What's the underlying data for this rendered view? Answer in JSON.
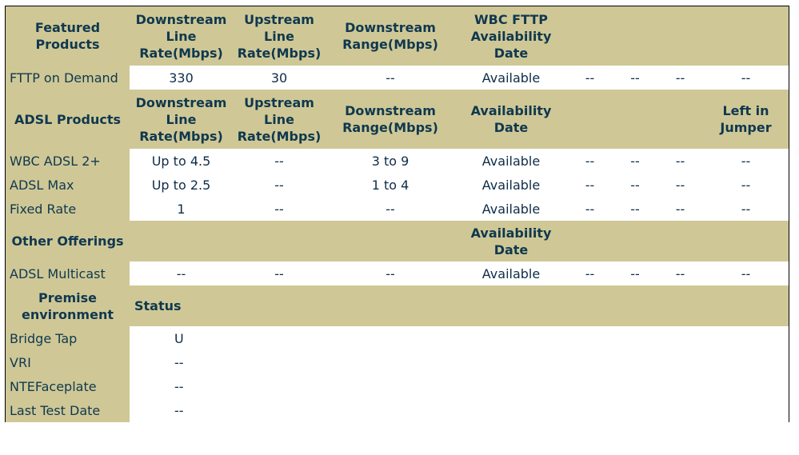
{
  "featured": {
    "headers": [
      "Featured Products",
      "Downstream Line Rate(Mbps)",
      "Upstream Line Rate(Mbps)",
      "Downstream Range(Mbps)",
      "WBC FTTP Availability Date",
      "",
      "",
      "",
      ""
    ],
    "rows": [
      [
        "FTTP on Demand",
        "330",
        "30",
        "--",
        "Available",
        "--",
        "--",
        "--",
        "--"
      ]
    ]
  },
  "adsl": {
    "headers": [
      "ADSL Products",
      "Downstream Line Rate(Mbps)",
      "Upstream Line Rate(Mbps)",
      "Downstream Range(Mbps)",
      "Availability Date",
      "",
      "",
      "",
      "Left in Jumper"
    ],
    "rows": [
      [
        "WBC ADSL 2+",
        "Up to 4.5",
        "--",
        "3 to 9",
        "Available",
        "--",
        "--",
        "--",
        "--"
      ],
      [
        "ADSL Max",
        "Up to 2.5",
        "--",
        "1 to 4",
        "Available",
        "--",
        "--",
        "--",
        "--"
      ],
      [
        "Fixed Rate",
        "1",
        "--",
        "--",
        "Available",
        "--",
        "--",
        "--",
        "--"
      ]
    ]
  },
  "other": {
    "headers": [
      "Other Offerings",
      "",
      "",
      "",
      "Availability Date",
      "",
      "",
      "",
      ""
    ],
    "rows": [
      [
        "ADSL Multicast",
        "--",
        "--",
        "--",
        "Available",
        "--",
        "--",
        "--",
        "--"
      ]
    ]
  },
  "premise": {
    "headers": [
      "Premise environment",
      "Status"
    ],
    "rows": [
      [
        "Bridge Tap",
        "U"
      ],
      [
        "VRI",
        "--"
      ],
      [
        "NTEFaceplate",
        "--"
      ],
      [
        "Last Test Date",
        "--"
      ]
    ]
  }
}
